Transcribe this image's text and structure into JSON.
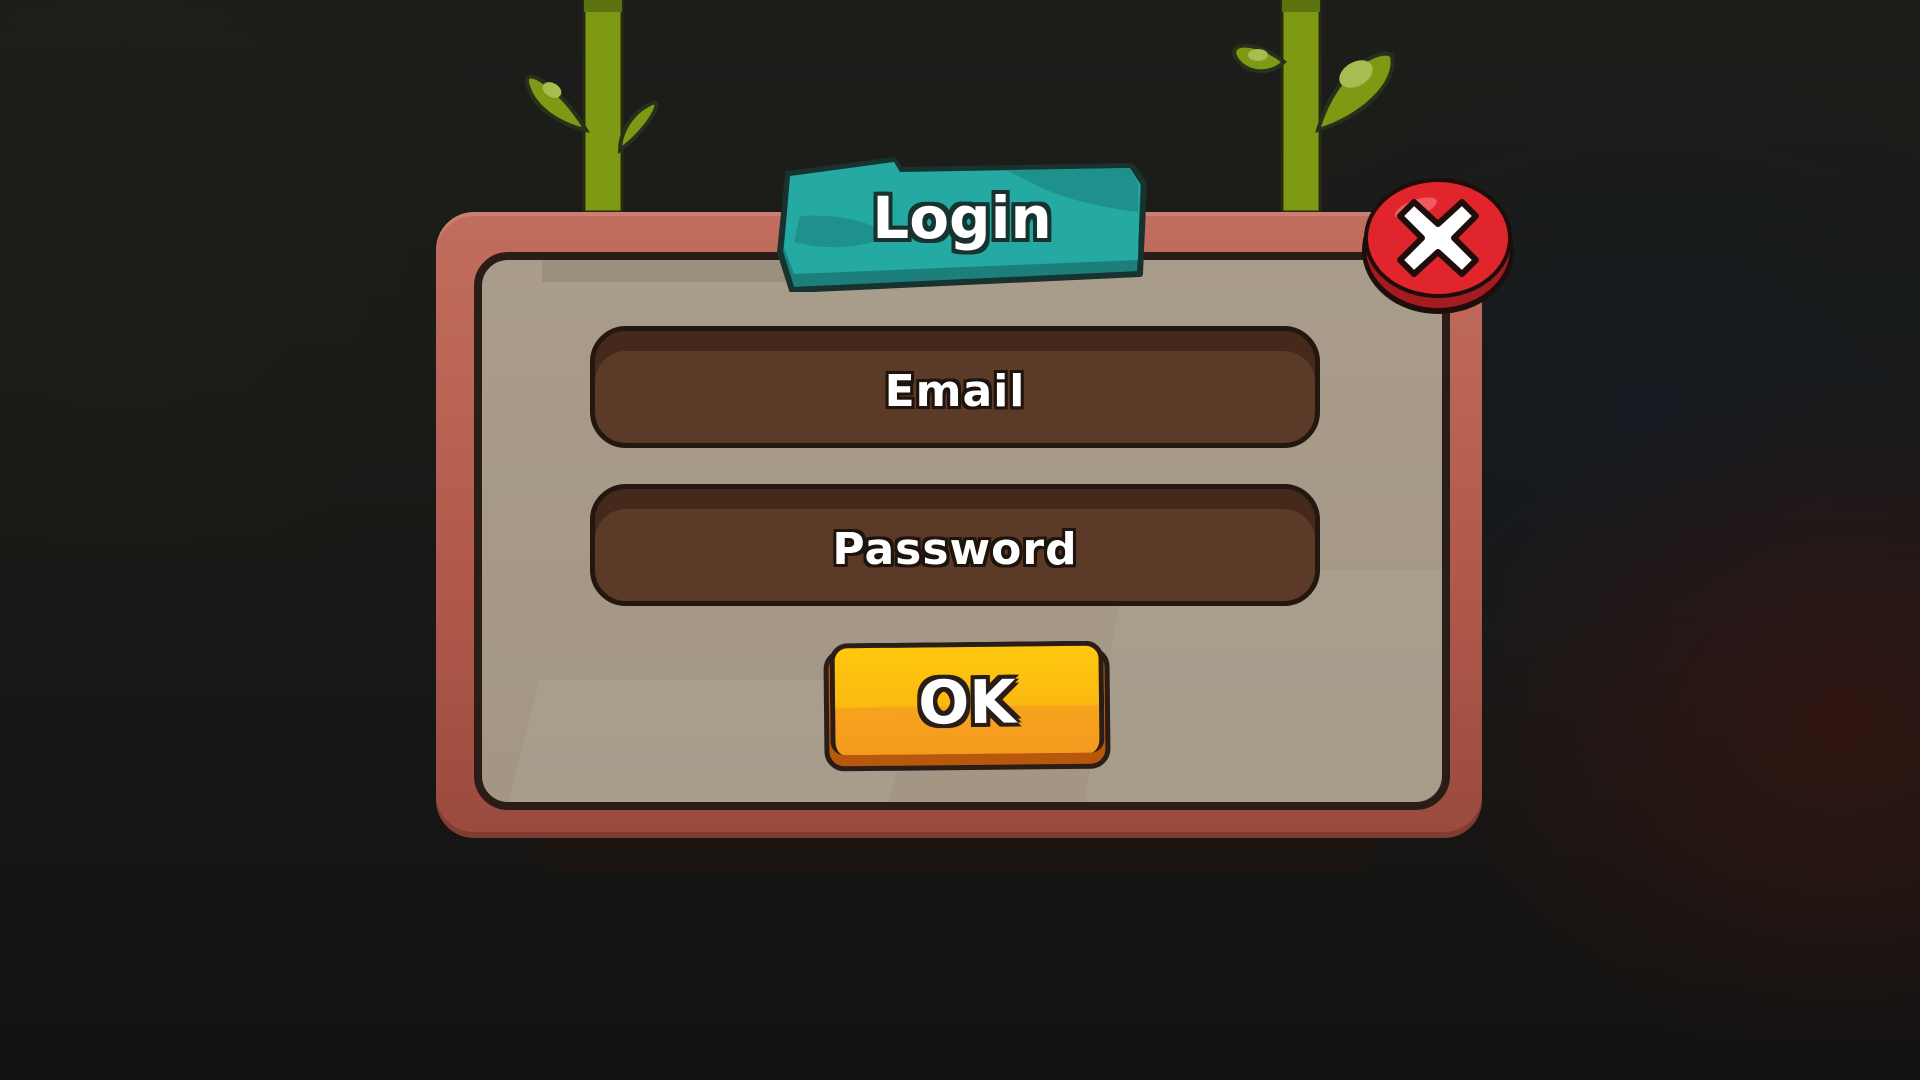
{
  "dialog": {
    "title": "Login",
    "email_label": "Email",
    "password_label": "Password",
    "ok_label": "OK"
  },
  "icons": {
    "close": "close-icon",
    "vine": "vine-icon"
  },
  "colors": {
    "frame": "#b65f50",
    "panel": "#a89b89",
    "field": "#5c3a28",
    "title_plate": "#1e9b95",
    "ok_button": "#fbb910",
    "close_button": "#d8232a",
    "vine": "#7e9a15"
  }
}
